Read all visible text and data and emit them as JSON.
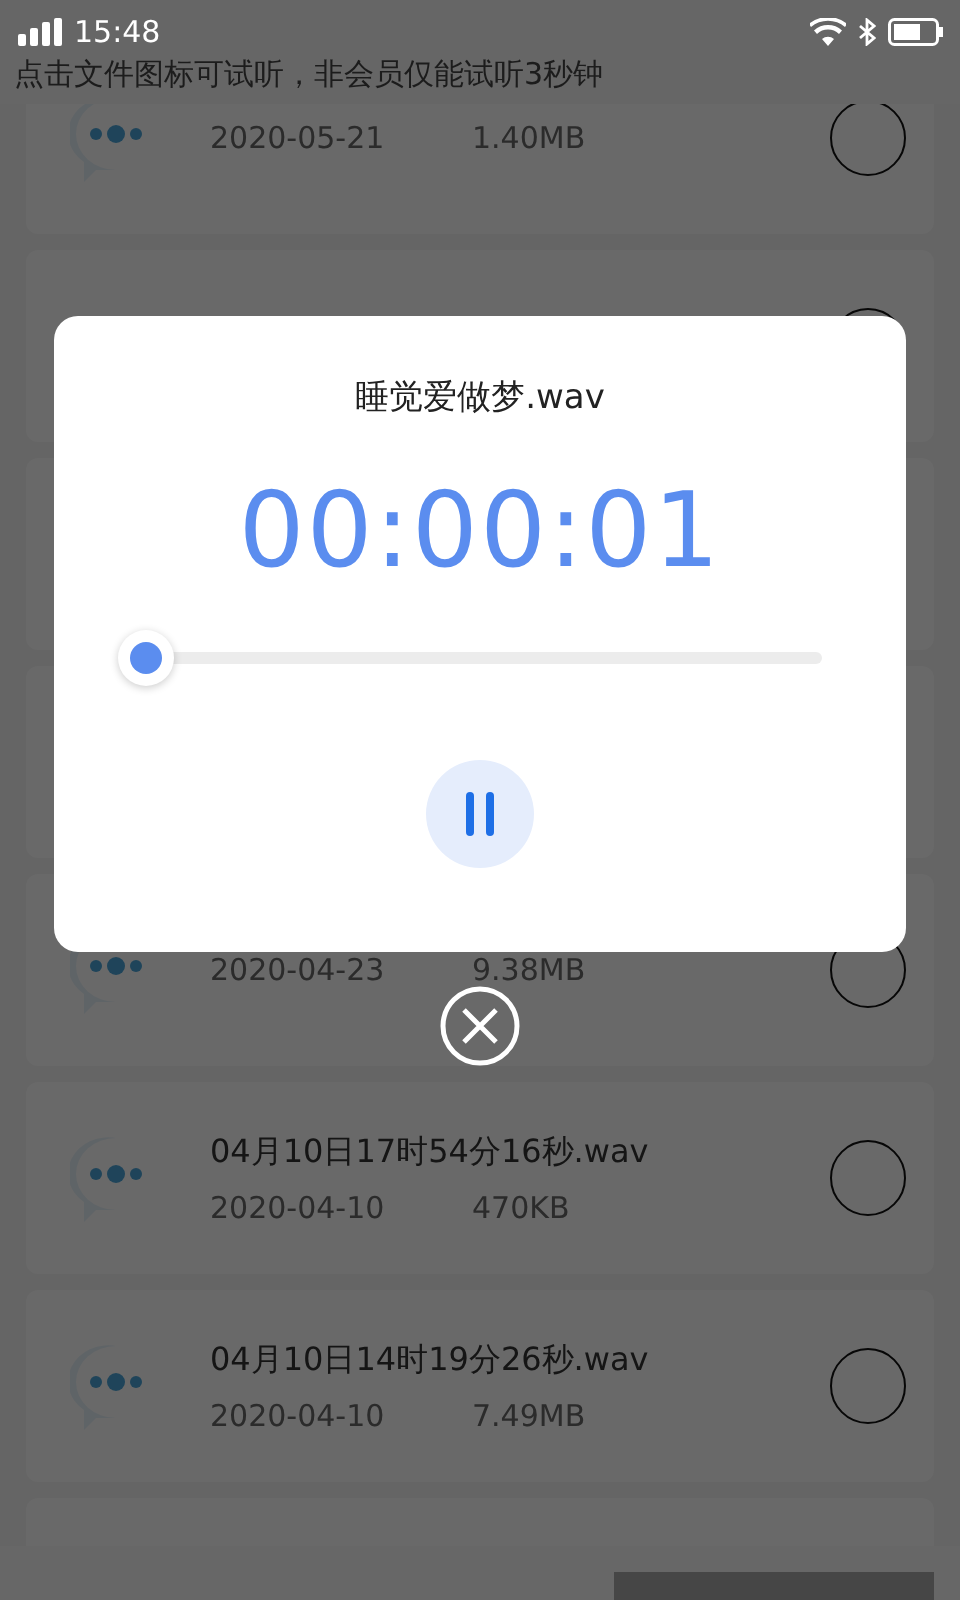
{
  "status_bar": {
    "time": "15:48"
  },
  "hint": "点击文件图标可试听，非会员仅能试听3秒钟",
  "files": [
    {
      "kind": "file",
      "date": "2020-05-21",
      "size": "1.40MB",
      "selected": false
    },
    {
      "kind": "file",
      "selected": false
    },
    {
      "kind": "blank"
    },
    {
      "kind": "blank"
    },
    {
      "kind": "file",
      "date": "2020-04-23",
      "size": "9.38MB",
      "selected": false
    },
    {
      "kind": "file",
      "title": "04月10日17时54分16秒.wav",
      "date": "2020-04-10",
      "size": "470KB",
      "selected": false
    },
    {
      "kind": "file",
      "title": "04月10日14时19分26秒.wav",
      "date": "2020-04-10",
      "size": "7.49MB",
      "selected": false
    },
    {
      "kind": "blank"
    }
  ],
  "player": {
    "title": "睡觉爱做梦.wav",
    "elapsed": "00:00:01",
    "level": 0,
    "playing": true
  }
}
